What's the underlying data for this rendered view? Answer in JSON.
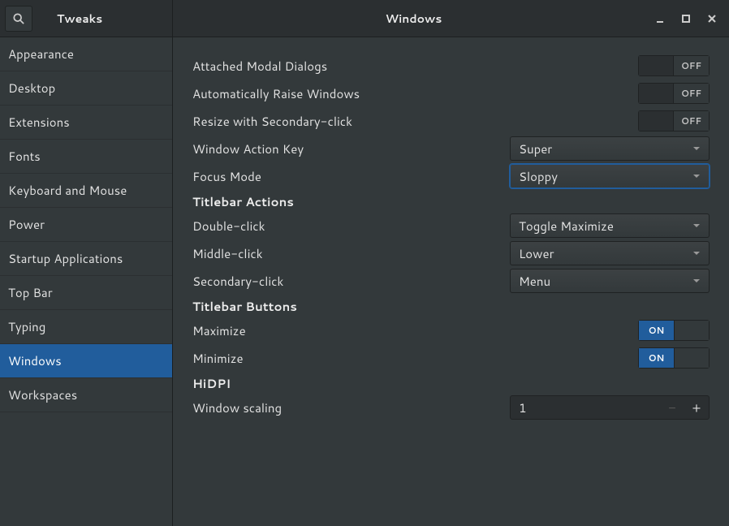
{
  "app_title": "Tweaks",
  "page_title": "Windows",
  "sidebar": {
    "items": [
      {
        "label": "Appearance"
      },
      {
        "label": "Desktop"
      },
      {
        "label": "Extensions"
      },
      {
        "label": "Fonts"
      },
      {
        "label": "Keyboard and Mouse"
      },
      {
        "label": "Power"
      },
      {
        "label": "Startup Applications"
      },
      {
        "label": "Top Bar"
      },
      {
        "label": "Typing"
      },
      {
        "label": "Windows"
      },
      {
        "label": "Workspaces"
      }
    ],
    "selected": "Windows"
  },
  "toggles": {
    "off": "OFF",
    "on": "ON"
  },
  "settings": {
    "attached_modal": {
      "label": "Attached Modal Dialogs",
      "value": "OFF"
    },
    "auto_raise": {
      "label": "Automatically Raise Windows",
      "value": "OFF"
    },
    "resize_secondary": {
      "label": "Resize with Secondary-click",
      "value": "OFF"
    },
    "window_action_key": {
      "label": "Window Action Key",
      "value": "Super"
    },
    "focus_mode": {
      "label": "Focus Mode",
      "value": "Sloppy"
    }
  },
  "titlebar_actions": {
    "header": "Titlebar Actions",
    "double_click": {
      "label": "Double-click",
      "value": "Toggle Maximize"
    },
    "middle_click": {
      "label": "Middle-click",
      "value": "Lower"
    },
    "secondary_click": {
      "label": "Secondary-click",
      "value": "Menu"
    }
  },
  "titlebar_buttons": {
    "header": "Titlebar Buttons",
    "maximize": {
      "label": "Maximize",
      "value": "ON"
    },
    "minimize": {
      "label": "Minimize",
      "value": "ON"
    }
  },
  "hidpi": {
    "header": "HiDPI",
    "window_scaling": {
      "label": "Window scaling",
      "value": "1"
    }
  }
}
